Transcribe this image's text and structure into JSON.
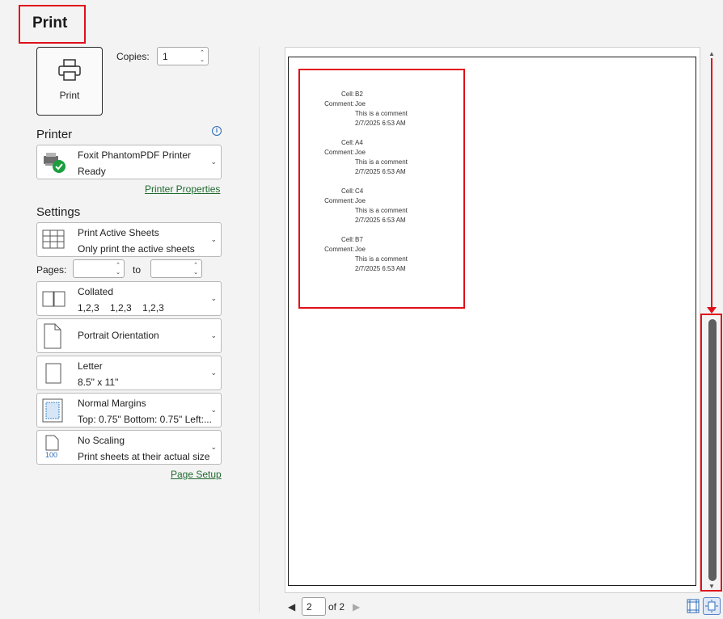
{
  "title": "Print",
  "print_button": {
    "label": "Print"
  },
  "copies": {
    "label": "Copies:",
    "value": "1"
  },
  "printer": {
    "section_label": "Printer",
    "name": "Foxit PhantomPDF Printer",
    "status": "Ready",
    "properties_link": "Printer Properties"
  },
  "settings": {
    "section_label": "Settings",
    "what": {
      "line1": "Print Active Sheets",
      "line2": "Only print the active sheets"
    },
    "pages_label": "Pages:",
    "to_label": "to",
    "collation": {
      "line1": "Collated",
      "line2": "1,2,3    1,2,3    1,2,3"
    },
    "orientation": {
      "line1": "Portrait Orientation"
    },
    "paper": {
      "line1": "Letter",
      "line2": "8.5\" x 11\""
    },
    "margins": {
      "line1": "Normal Margins",
      "line2": "Top: 0.75\" Bottom: 0.75\" Left:..."
    },
    "scaling": {
      "line1": "No Scaling",
      "line2": "Print sheets at their actual size",
      "icon_text": "100"
    },
    "page_setup_link": "Page Setup"
  },
  "preview": {
    "comments": [
      {
        "cell_label": "Cell:",
        "cell": "B2",
        "comment_label": "Comment:",
        "author": "Joe",
        "text": "This is a comment",
        "date": "2/7/2025 6:53 AM"
      },
      {
        "cell_label": "Cell:",
        "cell": "A4",
        "comment_label": "Comment:",
        "author": "Joe",
        "text": "This is a comment",
        "date": "2/7/2025 6:53 AM"
      },
      {
        "cell_label": "Cell:",
        "cell": "C4",
        "comment_label": "Comment:",
        "author": "Joe",
        "text": "This is a comment",
        "date": "2/7/2025 6:53 AM"
      },
      {
        "cell_label": "Cell:",
        "cell": "B7",
        "comment_label": "Comment:",
        "author": "Joe",
        "text": "This is a comment",
        "date": "2/7/2025 6:53 AM"
      }
    ]
  },
  "nav": {
    "current_page": "2",
    "of_label": "of 2"
  },
  "colors": {
    "highlight": "#e0101a",
    "link": "#1f6a2f",
    "info": "#2a6ab7"
  }
}
